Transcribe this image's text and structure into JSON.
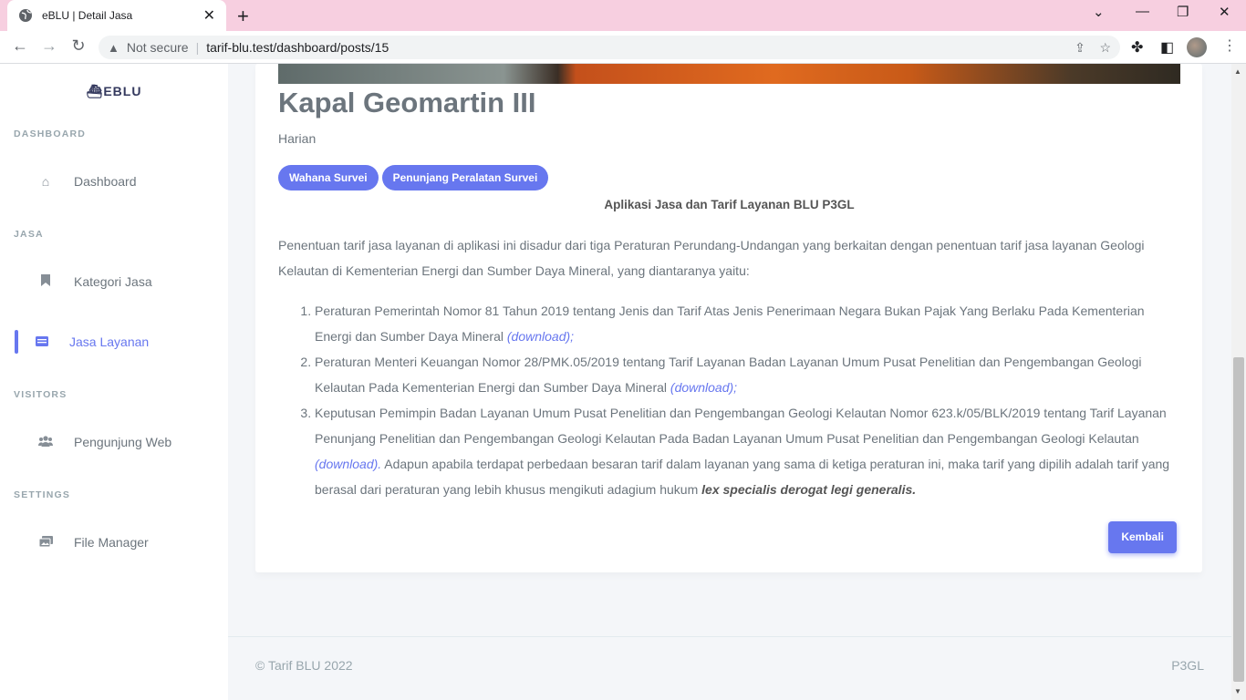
{
  "browser": {
    "tab_title": "eBLU | Detail Jasa",
    "security_label": "Not secure",
    "url": "tarif-blu.test/dashboard/posts/15"
  },
  "sidebar": {
    "brand": "EBLU",
    "sections": {
      "dashboard": "DASHBOARD",
      "jasa": "JASA",
      "visitors": "VISITORS",
      "settings": "SETTINGS"
    },
    "items": {
      "dashboard": "Dashboard",
      "kategori": "Kategori Jasa",
      "layanan": "Jasa Layanan",
      "pengunjung": "Pengunjung Web",
      "file_manager": "File Manager"
    }
  },
  "post": {
    "title": "Kapal Geomartin III",
    "subtitle": "Harian",
    "badges": [
      "Wahana Survei",
      "Penunjang Peralatan Survei"
    ],
    "heading": "Aplikasi Jasa dan Tarif Layanan BLU P3GL",
    "intro": "Penentuan tarif jasa layanan di aplikasi ini disadur dari tiga Peraturan Perundang-Undangan yang berkaitan dengan penentuan tarif jasa layanan Geologi Kelautan di Kementerian Energi dan Sumber Daya Mineral, yang diantaranya yaitu:",
    "list": [
      {
        "text": "Peraturan Pemerintah Nomor 81 Tahun 2019 tentang Jenis dan Tarif Atas Jenis Penerimaan Negara Bukan Pajak Yang Berlaku Pada Kementerian Energi dan Sumber Daya Mineral ",
        "link": "(download);"
      },
      {
        "text": "Peraturan Menteri Keuangan Nomor 28/PMK.05/2019 tentang Tarif Layanan Badan Layanan Umum Pusat Penelitian dan Pengembangan Geologi Kelautan Pada Kementerian Energi dan Sumber Daya Mineral ",
        "link": "(download);"
      },
      {
        "text": "Keputusan Pemimpin Badan Layanan Umum Pusat Penelitian dan Pengembangan Geologi Kelautan Nomor 623.k/05/BLK/2019 tentang Tarif Layanan Penunjang Penelitian dan Pengembangan Geologi Kelautan Pada Badan Layanan Umum Pusat Penelitian dan Pengembangan Geologi Kelautan ",
        "link": "(download).",
        "after": " Adapun apabila terdapat perbedaan besaran tarif dalam layanan yang sama di ketiga peraturan ini, maka tarif yang dipilih adalah tarif yang berasal dari peraturan yang lebih khusus mengikuti adagium hukum ",
        "emphasis": "lex specialis derogat legi generalis."
      }
    ],
    "back_button": "Kembali"
  },
  "footer": {
    "left": "© Tarif BLU 2022",
    "right": "P3GL"
  }
}
